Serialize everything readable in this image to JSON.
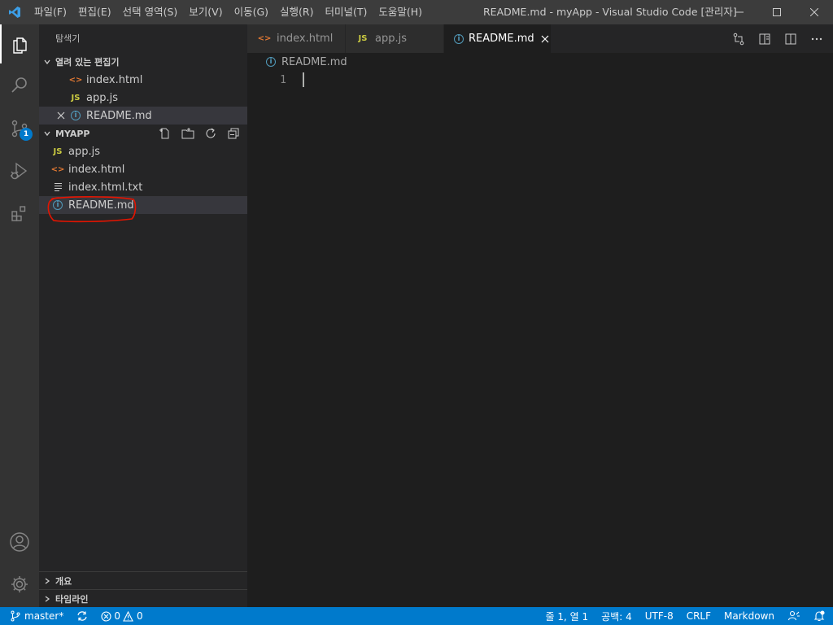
{
  "titlebar": {
    "menu": [
      "파일(F)",
      "편집(E)",
      "선택 영역(S)",
      "보기(V)",
      "이동(G)",
      "실행(R)",
      "터미널(T)",
      "도움말(H)"
    ],
    "title": "README.md - myApp - Visual Studio Code [관리자]"
  },
  "activitybar": {
    "items": [
      "explorer-icon",
      "search-icon",
      "source-control-icon",
      "run-debug-icon",
      "extensions-icon"
    ],
    "scm_badge": "1",
    "bottom": [
      "account-icon",
      "settings-gear-icon"
    ]
  },
  "sidebar": {
    "title": "탐색기",
    "open_editors": {
      "label": "열려 있는 편집기",
      "items": [
        {
          "name": "index.html",
          "icon": "html-icon"
        },
        {
          "name": "app.js",
          "icon": "js-icon"
        },
        {
          "name": "README.md",
          "icon": "info-icon"
        }
      ]
    },
    "project": {
      "label": "MYAPP",
      "files": [
        {
          "name": "app.js",
          "icon": "js-icon"
        },
        {
          "name": "index.html",
          "icon": "html-icon"
        },
        {
          "name": "index.html.txt",
          "icon": "text-file-icon"
        },
        {
          "name": "README.md",
          "icon": "info-icon"
        }
      ]
    },
    "outline_label": "개요",
    "timeline_label": "타임라인"
  },
  "editor": {
    "tabs": [
      {
        "name": "index.html",
        "icon": "html-icon"
      },
      {
        "name": "app.js",
        "icon": "js-icon"
      },
      {
        "name": "README.md",
        "icon": "info-icon",
        "active": true
      }
    ],
    "breadcrumb": "README.md",
    "line_numbers": [
      "1"
    ]
  },
  "statusbar": {
    "branch": "master*",
    "errors": "0",
    "warnings": "0",
    "position": "줄 1, 열 1",
    "spaces": "공백: 4",
    "encoding": "UTF-8",
    "eol": "CRLF",
    "language": "Markdown"
  },
  "colors": {
    "accent": "#007acc",
    "annotation": "#e51400",
    "js": "#cbcb41",
    "html": "#e37933",
    "info": "#519aba"
  }
}
